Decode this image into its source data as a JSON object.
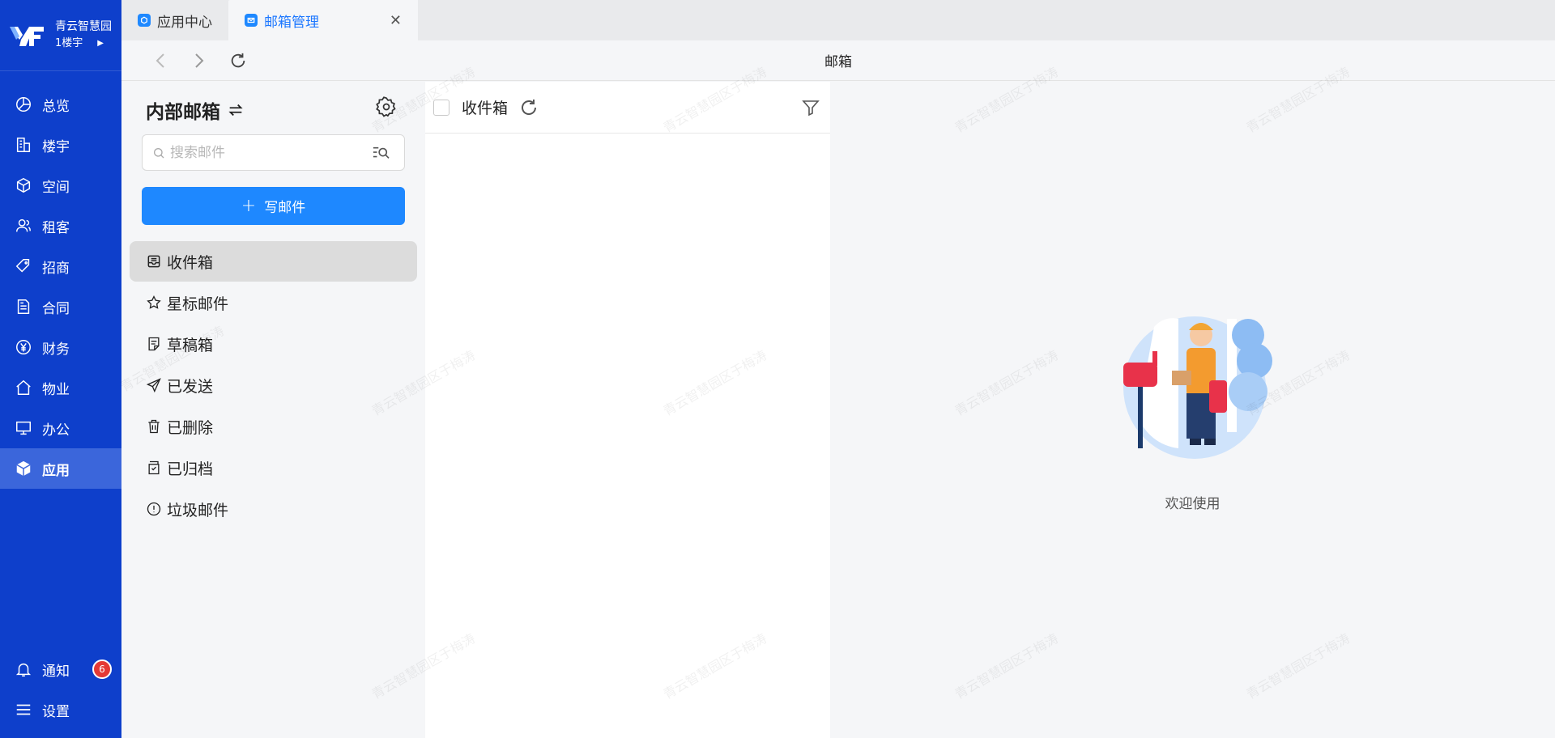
{
  "brand": {
    "name": "青云智慧园",
    "building": "1楼宇"
  },
  "nav": {
    "items": [
      {
        "label": "总览",
        "icon": "pie-chart-icon"
      },
      {
        "label": "楼宇",
        "icon": "building-icon"
      },
      {
        "label": "空间",
        "icon": "cube-icon"
      },
      {
        "label": "租客",
        "icon": "users-icon"
      },
      {
        "label": "招商",
        "icon": "tag-icon"
      },
      {
        "label": "合同",
        "icon": "document-icon"
      },
      {
        "label": "财务",
        "icon": "yen-circle-icon"
      },
      {
        "label": "物业",
        "icon": "home-icon"
      },
      {
        "label": "办公",
        "icon": "monitor-icon"
      },
      {
        "label": "应用",
        "icon": "app-cube-icon",
        "active": true
      }
    ],
    "bottom": {
      "notify_label": "通知",
      "notify_count": "6",
      "settings_label": "设置"
    }
  },
  "tabs": [
    {
      "label": "应用中心",
      "active": false
    },
    {
      "label": "邮箱管理",
      "active": true
    }
  ],
  "toolbar": {
    "title": "邮箱"
  },
  "mailbox": {
    "title": "内部邮箱",
    "search_placeholder": "搜索邮件",
    "compose_label": "写邮件",
    "folders": [
      {
        "label": "收件箱",
        "icon": "inbox-icon",
        "active": true
      },
      {
        "label": "星标邮件",
        "icon": "star-icon"
      },
      {
        "label": "草稿箱",
        "icon": "draft-icon"
      },
      {
        "label": "已发送",
        "icon": "send-icon"
      },
      {
        "label": "已删除",
        "icon": "trash-icon"
      },
      {
        "label": "已归档",
        "icon": "archive-icon"
      },
      {
        "label": "垃圾邮件",
        "icon": "spam-icon"
      }
    ]
  },
  "list": {
    "title": "收件箱"
  },
  "reader": {
    "welcome": "欢迎使用"
  },
  "watermark": "青云智慧园区于梅涛",
  "colors": {
    "nav_bg": "#0e3fcb",
    "nav_active": "#3b66db",
    "primary": "#1e88ff",
    "badge": "#e53935"
  }
}
